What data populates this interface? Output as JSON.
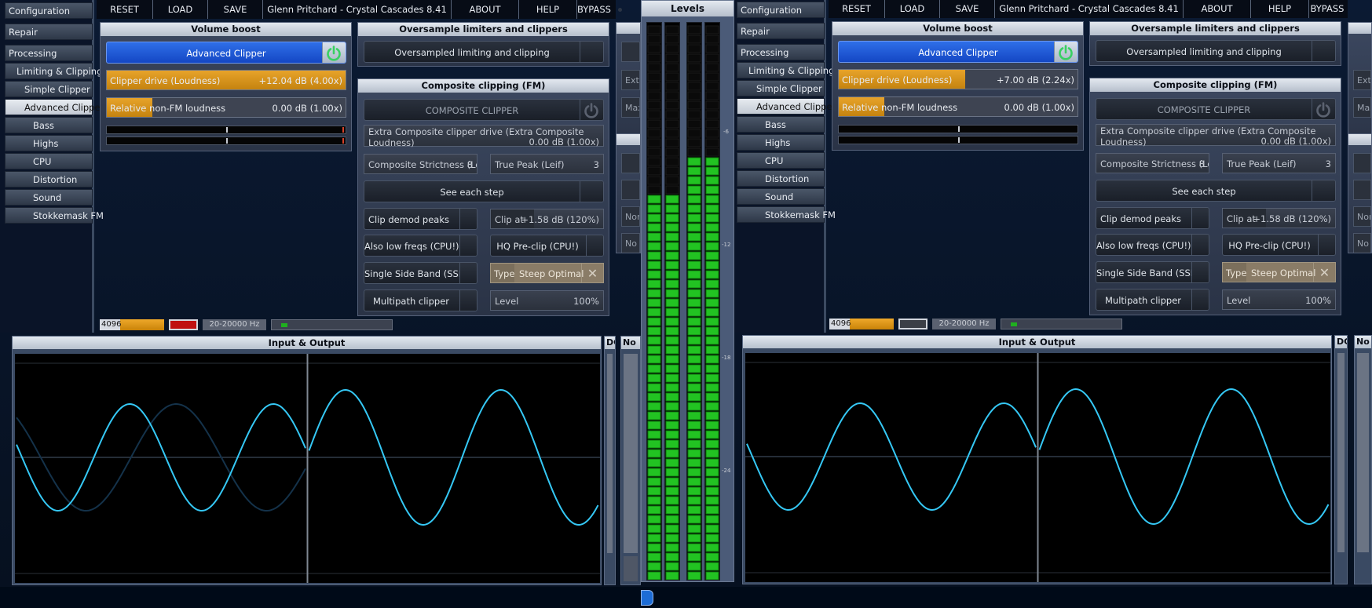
{
  "sidebar": {
    "configuration": "Configuration",
    "repair": "Repair",
    "processing": "Processing",
    "limiting_clipping": "Limiting & Clipping",
    "simple_clipper": "Simple Clipper",
    "advanced_clipper": "Advanced Clipper",
    "bass": "Bass",
    "highs": "Highs",
    "cpu": "CPU",
    "distortion": "Distortion",
    "sound": "Sound",
    "stokkemask": "Stokkemask FM"
  },
  "toolbar": {
    "reset": "RESET",
    "load": "LOAD",
    "save": "SAVE",
    "preset": "Glenn Pritchard - Crystal Cascades 8.41",
    "about": "ABOUT",
    "help": "HELP",
    "bypass": "BYPASS"
  },
  "volume_boost": {
    "title": "Volume boost",
    "advanced_clipper": "Advanced Clipper",
    "clipper_drive_label": "Clipper drive (Loudness)",
    "relative_label": "Relative non-FM loudness"
  },
  "oversample": {
    "title": "Oversample limiters and clippers",
    "button": "Oversampled limiting and clipping"
  },
  "composite": {
    "title": "Composite clipping (FM)",
    "composite_clipper": "COMPOSITE CLIPPER",
    "extra_label": "Extra Composite clipper drive (Extra Composite Loudness)",
    "extra_value": "0.00 dB (1.00x)",
    "strictness_label": "Composite Strictness (Leif)",
    "strictness_value": "8",
    "truepeak_label": "True Peak (Leif)",
    "truepeak_value": "3",
    "see_each_step": "See each step",
    "clip_demod": "Clip demod peaks",
    "clip_at_label": "Clip at",
    "clip_at_value": "+1.58 dB (120%)",
    "low_freqs": "Also low freqs (CPU!)",
    "hq_preclip": "HQ Pre-clip (CPU!)",
    "ssb": "Single Side Band (SSB)",
    "type_label": "Type",
    "type_value": "Steep Optimal",
    "type_clear": "✕",
    "multipath": "Multipath clipper",
    "level_label": "Level",
    "level_value": "100%"
  },
  "status": {
    "fft": "4096",
    "range": "20-20000 Hz"
  },
  "scope": {
    "title": "Input & Output",
    "side_dc": "DC",
    "side_no": "No"
  },
  "levels": {
    "title": "Levels",
    "scale": [
      "-6",
      "-12",
      "-18",
      "-24"
    ],
    "bars": [
      0.7,
      0.7,
      0.77,
      0.77
    ]
  },
  "crop": {
    "ext": "Extr",
    "max": "Max",
    "nor": "Nor",
    "nop": "No p"
  },
  "left": {
    "clipper_drive_value": "+12.04 dB (4.00x)",
    "clipper_drive_fill": 1.0,
    "relative_value": "0.00 dB (1.00x)",
    "relative_fill": 0.19,
    "fft_fill": 0.68,
    "indicator_color": "#c01010"
  },
  "right": {
    "clipper_drive_value": "+7.00 dB (2.24x)",
    "clipper_drive_fill": 0.53,
    "relative_value": "0.00 dB (1.00x)",
    "relative_fill": 0.19,
    "fft_fill": 0.68,
    "indicator_color": "#3b3f47"
  },
  "colors": {
    "accent_blue": "#1447c4",
    "slider_orange": "#e7a32a",
    "meter_green": "#22c322",
    "wave_cyan": "#35c8f5",
    "power_green": "#39d063"
  }
}
